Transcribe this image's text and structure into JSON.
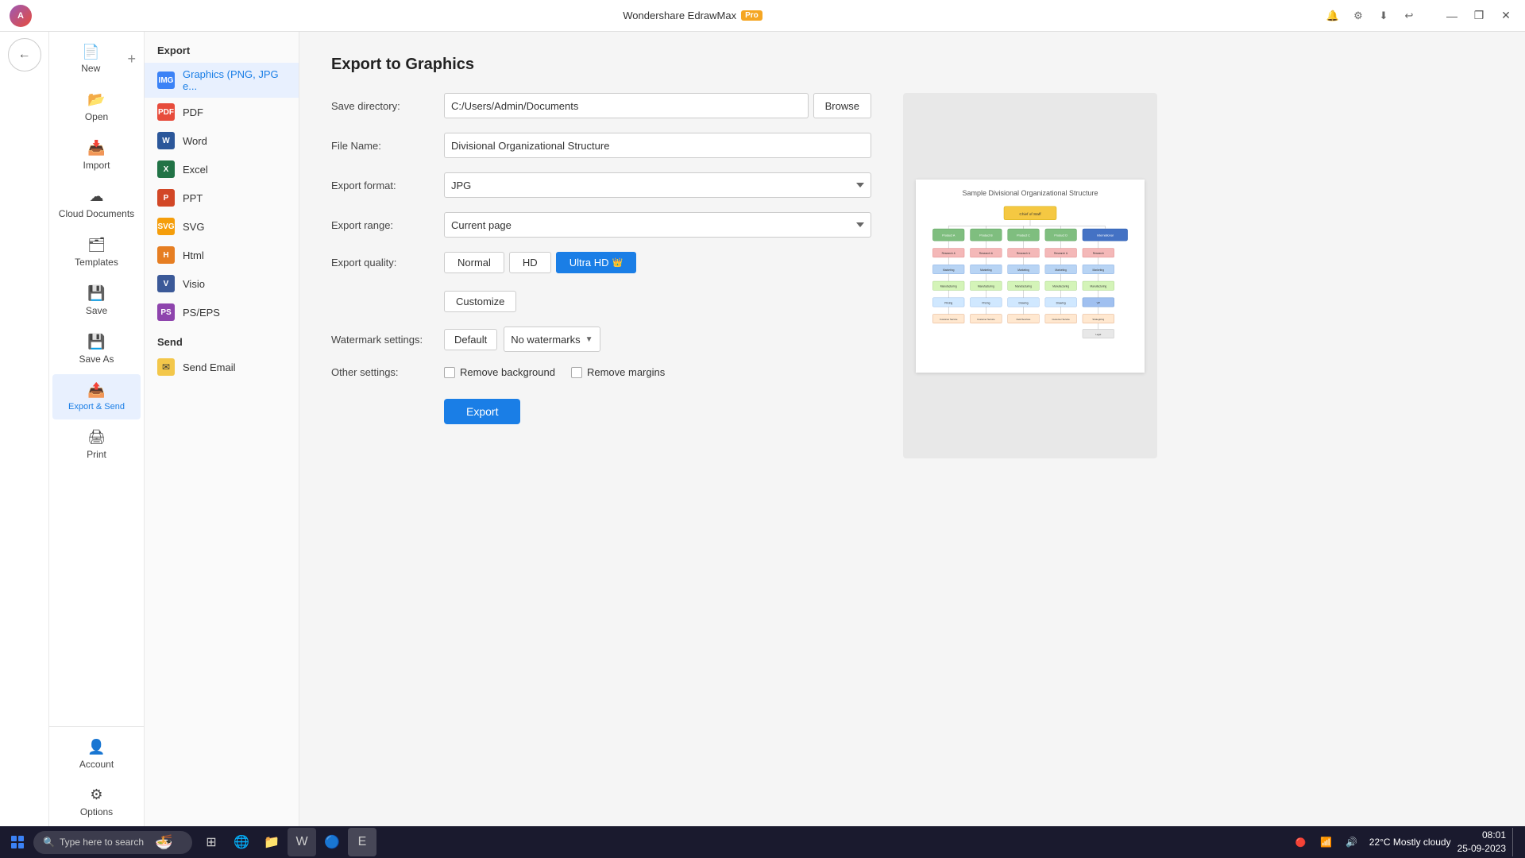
{
  "app": {
    "title": "Wondershare EdrawMax",
    "pro_badge": "Pro"
  },
  "titlebar": {
    "minimize": "—",
    "restore": "❐",
    "close": "✕"
  },
  "toolbar": {
    "icons": [
      "🔔",
      "≡",
      "⬇",
      "↩"
    ]
  },
  "sidebar": {
    "items": [
      {
        "label": "New",
        "icon": "📄",
        "id": "new"
      },
      {
        "label": "Open",
        "icon": "📂",
        "id": "open"
      },
      {
        "label": "Import",
        "icon": "📥",
        "id": "import"
      },
      {
        "label": "Cloud Documents",
        "icon": "☁",
        "id": "cloud"
      },
      {
        "label": "Templates",
        "icon": "🗂",
        "id": "templates"
      },
      {
        "label": "Save",
        "icon": "💾",
        "id": "save"
      },
      {
        "label": "Save As",
        "icon": "💾",
        "id": "saveas"
      },
      {
        "label": "Export & Send",
        "icon": "📤",
        "id": "export",
        "active": true
      },
      {
        "label": "Print",
        "icon": "🖨",
        "id": "print"
      }
    ],
    "bottom": [
      {
        "label": "Account",
        "icon": "👤",
        "id": "account"
      },
      {
        "label": "Options",
        "icon": "⚙",
        "id": "options"
      }
    ]
  },
  "format_list": {
    "title": "Export",
    "formats": [
      {
        "id": "png",
        "label": "Graphics (PNG, JPG e...",
        "color": "#3b82f6",
        "abbr": "IMG",
        "active": true
      },
      {
        "id": "pdf",
        "label": "PDF",
        "color": "#e74c3c",
        "abbr": "PDF"
      },
      {
        "id": "word",
        "label": "Word",
        "color": "#2b579a",
        "abbr": "W"
      },
      {
        "id": "excel",
        "label": "Excel",
        "color": "#217346",
        "abbr": "X"
      },
      {
        "id": "ppt",
        "label": "PPT",
        "color": "#d24726",
        "abbr": "P"
      },
      {
        "id": "svg",
        "label": "SVG",
        "color": "#f59e0b",
        "abbr": "SVG"
      },
      {
        "id": "html",
        "label": "Html",
        "color": "#e67e22",
        "abbr": "H"
      },
      {
        "id": "visio",
        "label": "Visio",
        "color": "#3b5998",
        "abbr": "V"
      },
      {
        "id": "pseps",
        "label": "PS/EPS",
        "color": "#8e44ad",
        "abbr": "PS"
      }
    ],
    "send_title": "Send",
    "send_items": [
      {
        "id": "email",
        "label": "Send Email"
      }
    ]
  },
  "export_form": {
    "page_title": "Export to Graphics",
    "save_directory_label": "Save directory:",
    "save_directory_value": "C:/Users/Admin/Documents",
    "browse_label": "Browse",
    "file_name_label": "File Name:",
    "file_name_value": "Divisional Organizational Structure",
    "export_format_label": "Export format:",
    "export_format_value": "JPG",
    "export_range_label": "Export range:",
    "export_range_value": "Current page",
    "export_quality_label": "Export quality:",
    "quality_normal": "Normal",
    "quality_hd": "HD",
    "quality_uhd": "Ultra HD",
    "customize_label": "Customize",
    "watermark_label": "Watermark settings:",
    "watermark_default": "Default",
    "watermark_none": "No watermarks",
    "other_settings_label": "Other settings:",
    "remove_background_label": "Remove background",
    "remove_margins_label": "Remove margins",
    "export_button": "Export"
  },
  "preview": {
    "diagram_title": "Sample Divisional Organizational Structure"
  },
  "taskbar": {
    "search_placeholder": "Type here to search",
    "time": "08:01",
    "date": "25-09-2023",
    "weather": "22°C  Mostly cloudy"
  }
}
